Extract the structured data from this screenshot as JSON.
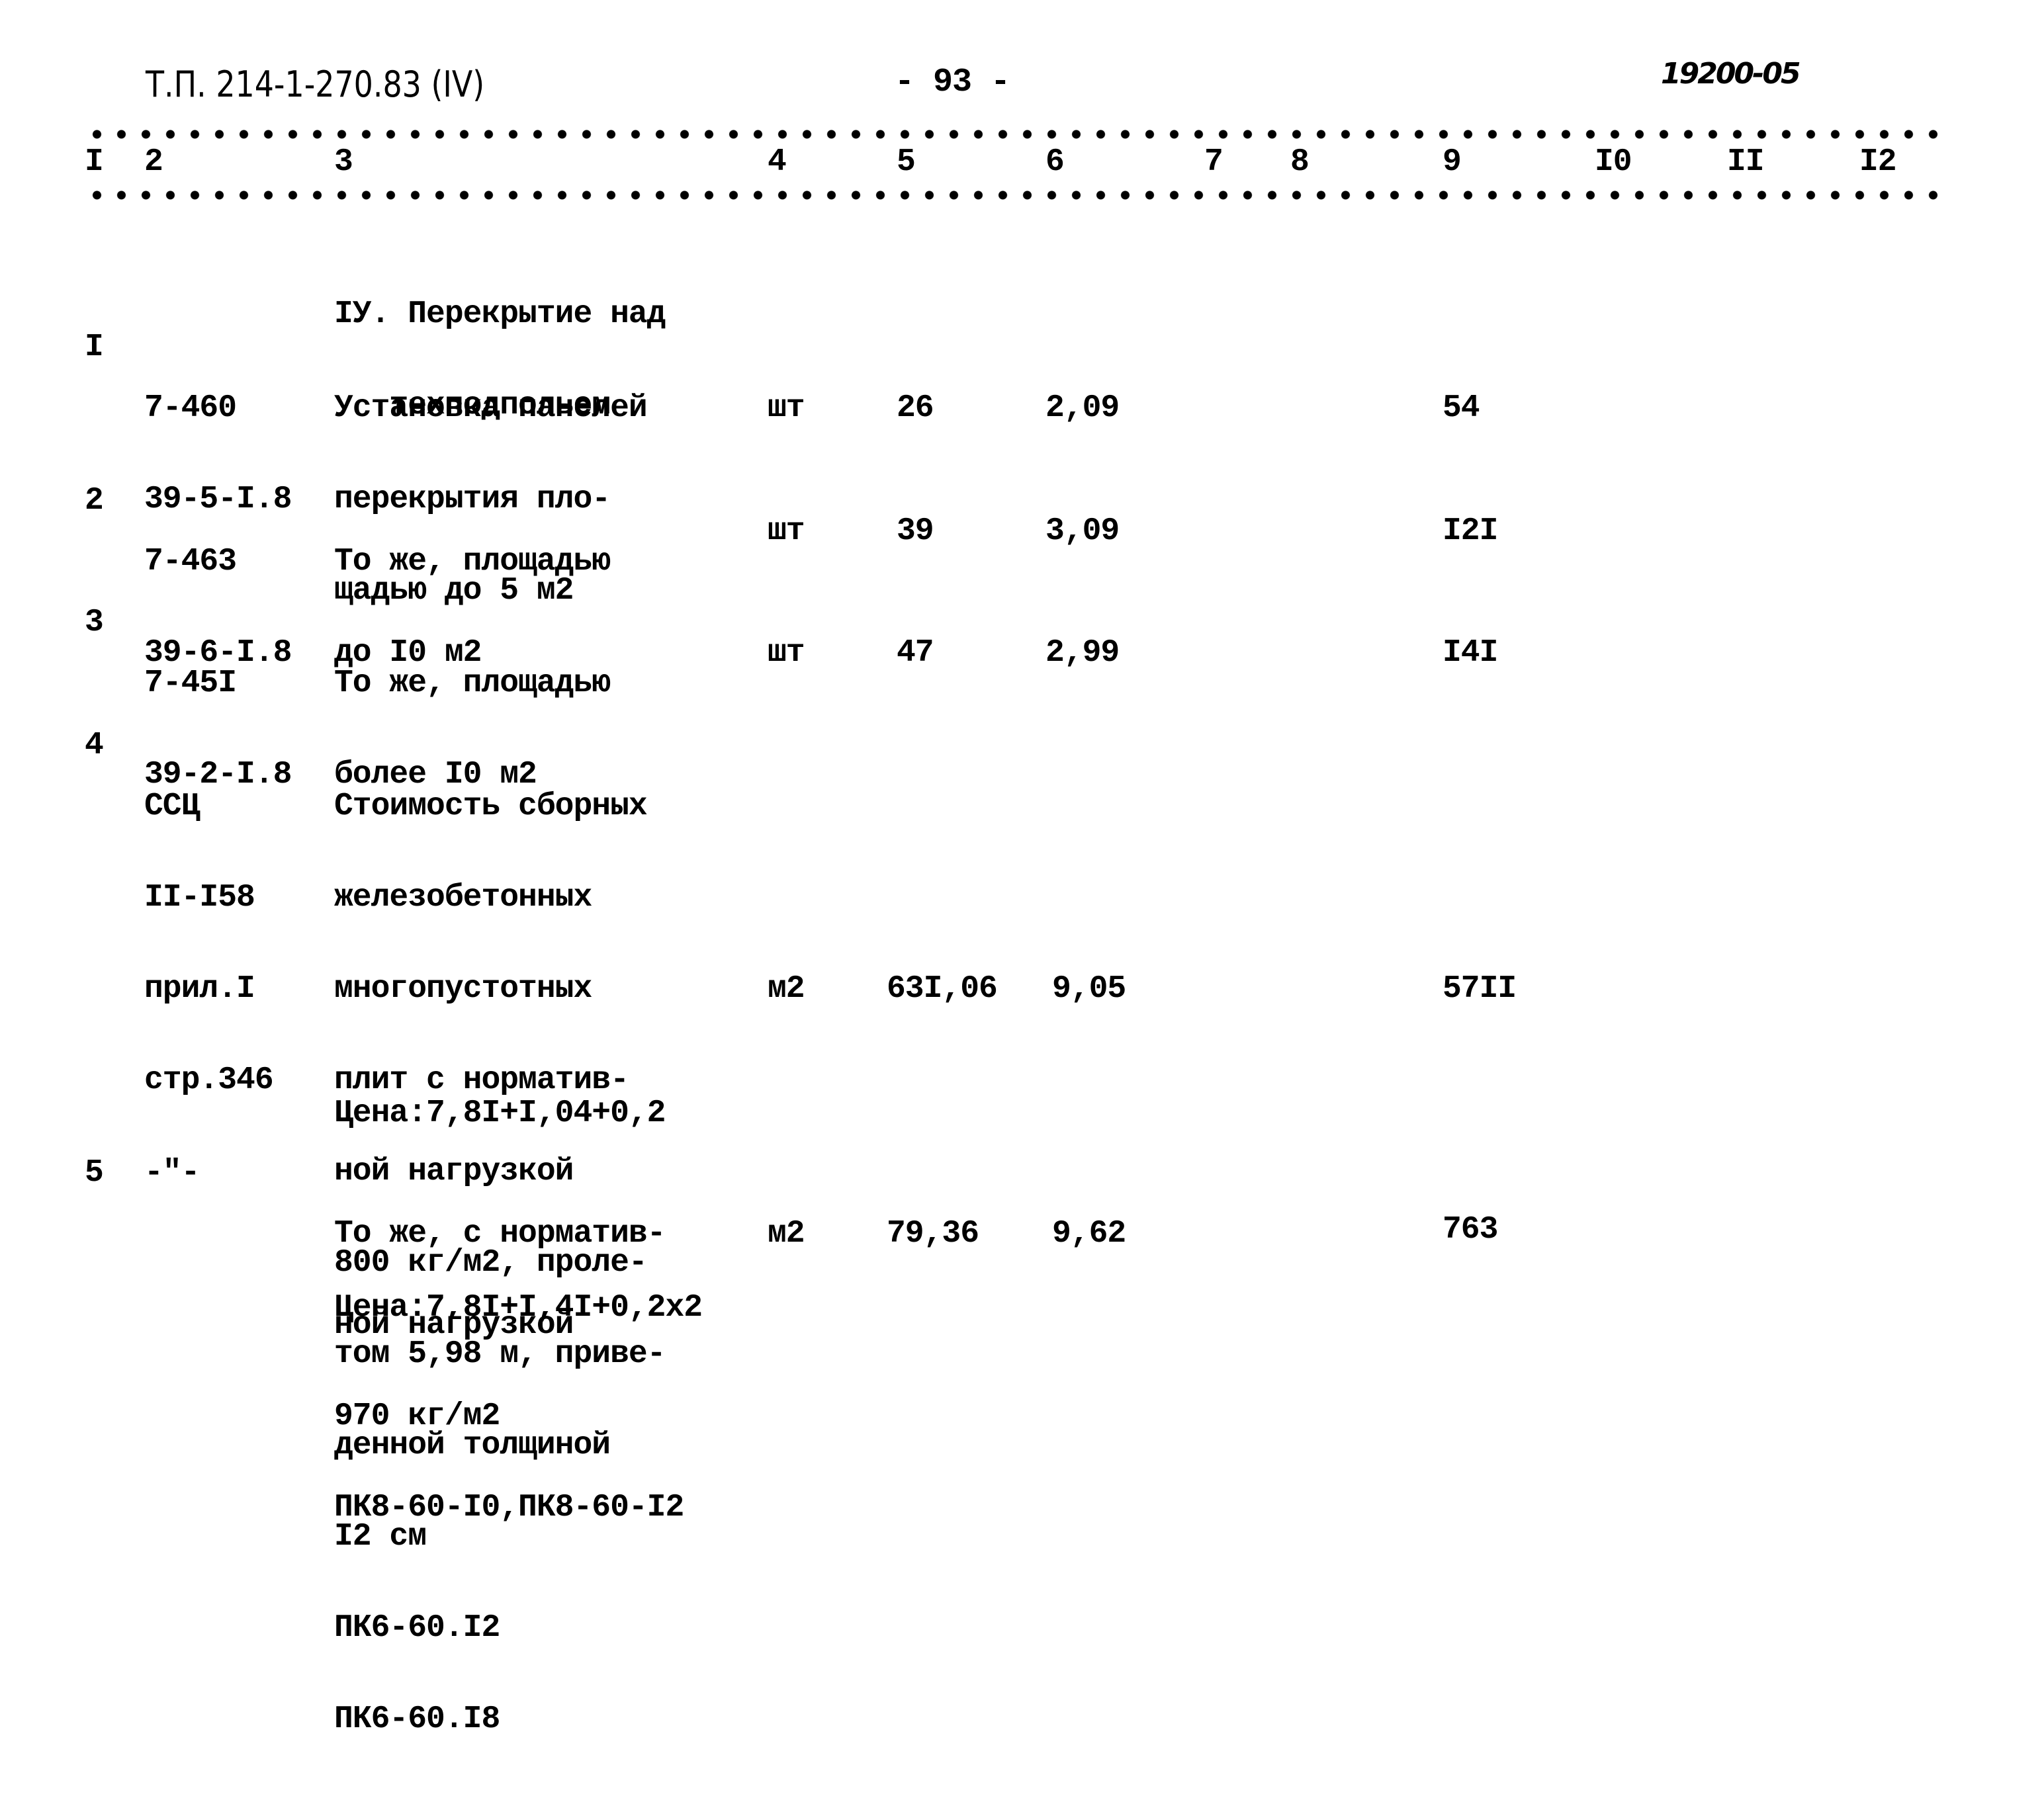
{
  "header": {
    "doc_code": "Т.П. 214-1-270.83 (IV)",
    "page_number": "- 93 -",
    "stamp": "19200-05"
  },
  "column_headers": [
    "I",
    "2",
    "3",
    "4",
    "5",
    "6",
    "7",
    "8",
    "9",
    "I0",
    "II",
    "I2"
  ],
  "section": {
    "title_lines": [
      "IУ. Перекрытие над",
      "   техподпольем"
    ]
  },
  "rows": [
    {
      "num": "I",
      "code_lines": [
        "7-460",
        "39-5-I.8"
      ],
      "desc_lines": [
        "Установка панелей",
        "перекрытия пло-",
        "щадью до 5 м2"
      ],
      "unit": "шт",
      "qty": "26",
      "price": "2,09",
      "total": "54"
    },
    {
      "num": "2",
      "code_lines": [
        "7-463",
        "39-6-I.8"
      ],
      "desc_lines": [
        "То же, площадью",
        "до I0 м2"
      ],
      "unit": "шт",
      "qty": "39",
      "price": "3,09",
      "total": "I2I"
    },
    {
      "num": "3",
      "code_lines": [
        "7-45I",
        "39-2-I.8"
      ],
      "desc_lines": [
        "То же, площадью",
        "более I0 м2"
      ],
      "unit": "шт",
      "qty": "47",
      "price": "2,99",
      "total": "I4I"
    },
    {
      "num": "4",
      "code_lines": [
        "ССЦ",
        "II-I58",
        "прил.I",
        "стр.346"
      ],
      "desc_lines": [
        "Стоимость сборных",
        "железобетонных",
        "многопустотных",
        "плит с норматив-",
        "ной нагрузкой",
        "800 кг/м2, проле-",
        "том 5,98 м, приве-",
        "денной толщиной",
        "I2 см",
        "ПК6-60.I2",
        "ПК6-60.I8"
      ],
      "price_note": "Цена:7,8I+I,04+0,2",
      "unit": "м2",
      "qty": "63I,06",
      "price": "9,05",
      "total": "57II"
    },
    {
      "num": "5",
      "code_lines": [
        "-\"-"
      ],
      "desc_lines": [
        "То же, с норматив-",
        "ной нагрузкой",
        "970 кг/м2",
        "ПК8-60-I0,ПК8-60-I2"
      ],
      "price_note": "Цена:7,8I+I,4I+0,2x2",
      "unit": "м2",
      "qty": "79,36",
      "price": "9,62",
      "total": "763"
    }
  ]
}
